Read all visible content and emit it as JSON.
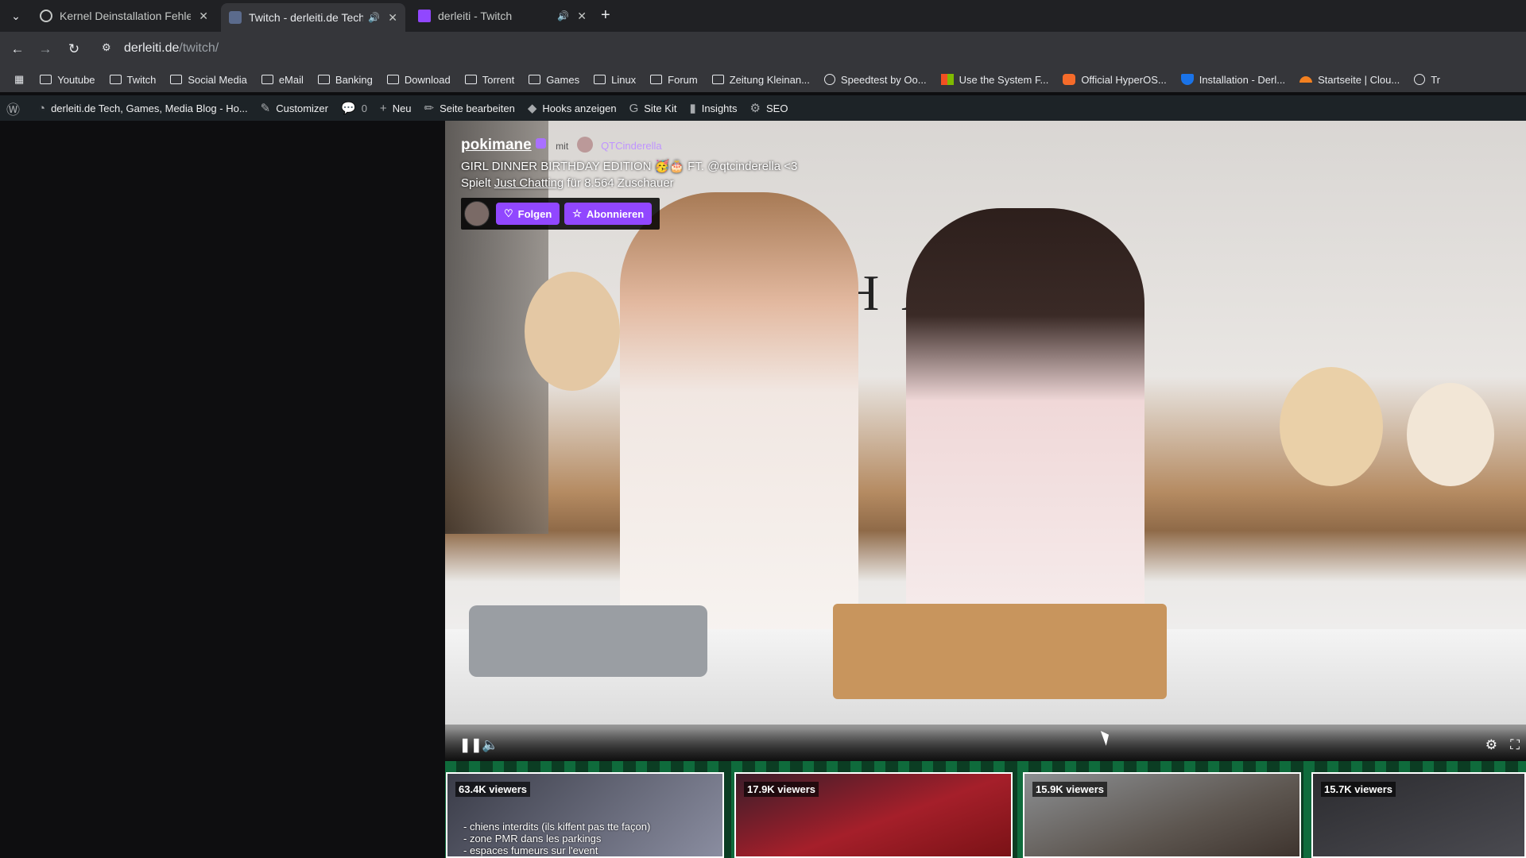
{
  "tabs": [
    {
      "title": "Kernel Deinstallation Fehle",
      "active": false,
      "audio": false
    },
    {
      "title": "Twitch - derleiti.de Tech",
      "active": true,
      "audio": true
    },
    {
      "title": "derleiti - Twitch",
      "active": false,
      "audio": true
    }
  ],
  "toolbar": {
    "url_host": "derleiti.de",
    "url_path": "/twitch/"
  },
  "bookmarks": [
    {
      "label": "Youtube",
      "icon": "folder-icon"
    },
    {
      "label": "Twitch",
      "icon": "folder-icon"
    },
    {
      "label": "Social Media",
      "icon": "folder-icon"
    },
    {
      "label": "eMail",
      "icon": "folder-icon"
    },
    {
      "label": "Banking",
      "icon": "folder-icon"
    },
    {
      "label": "Download",
      "icon": "folder-icon"
    },
    {
      "label": "Torrent",
      "icon": "folder-icon"
    },
    {
      "label": "Games",
      "icon": "folder-icon"
    },
    {
      "label": "Linux",
      "icon": "folder-icon"
    },
    {
      "label": "Forum",
      "icon": "folder-icon"
    },
    {
      "label": "Zeitung Kleinan...",
      "icon": "folder-icon"
    },
    {
      "label": "Speedtest by Oo...",
      "icon": "speedtest-icon"
    },
    {
      "label": "Use the System F...",
      "icon": "windows-icon"
    },
    {
      "label": "Official HyperOS...",
      "icon": "hyperos-icon"
    },
    {
      "label": "Installation - Derl...",
      "icon": "shield-icon"
    },
    {
      "label": "Startseite | Clou...",
      "icon": "cloud-icon"
    },
    {
      "label": "Tr",
      "icon": "globe-icon"
    }
  ],
  "wpbar": {
    "site": "derleiti.de Tech, Games, Media Blog - Ho...",
    "customizer": "Customizer",
    "comments": "0",
    "new": "Neu",
    "edit": "Seite bearbeiten",
    "hooks": "Hooks anzeigen",
    "sitekit": "Site Kit",
    "insights": "Insights",
    "seo": "SEO"
  },
  "stream": {
    "channel": "pokimane",
    "with": "mit",
    "cohost": "QTCinderella",
    "title": "GIRL DINNER BIRTHDAY EDITION 🥳🎂 FT. @qtcinderella <3",
    "playing_prefix": "Spielt",
    "game": "Just Chatting",
    "playing_suffix": "für 8.564 Zuschauer",
    "follow": "Folgen",
    "subscribe": "Abonnieren",
    "banner_text": "HA"
  },
  "recommended": [
    {
      "viewers": "63.4K viewers",
      "caption": [
        "- chiens interdits (ils kiffent pas tte façon)",
        "- zone PMR dans les parkings",
        "- espaces fumeurs sur l'event"
      ],
      "color": "#3a3c48"
    },
    {
      "viewers": "17.9K viewers",
      "caption": [],
      "color": "#8c1c24"
    },
    {
      "viewers": "15.9K viewers",
      "caption": [],
      "color": "#5d5650"
    },
    {
      "viewers": "15.7K viewers",
      "caption": [],
      "color": "#3b3b3e"
    }
  ]
}
